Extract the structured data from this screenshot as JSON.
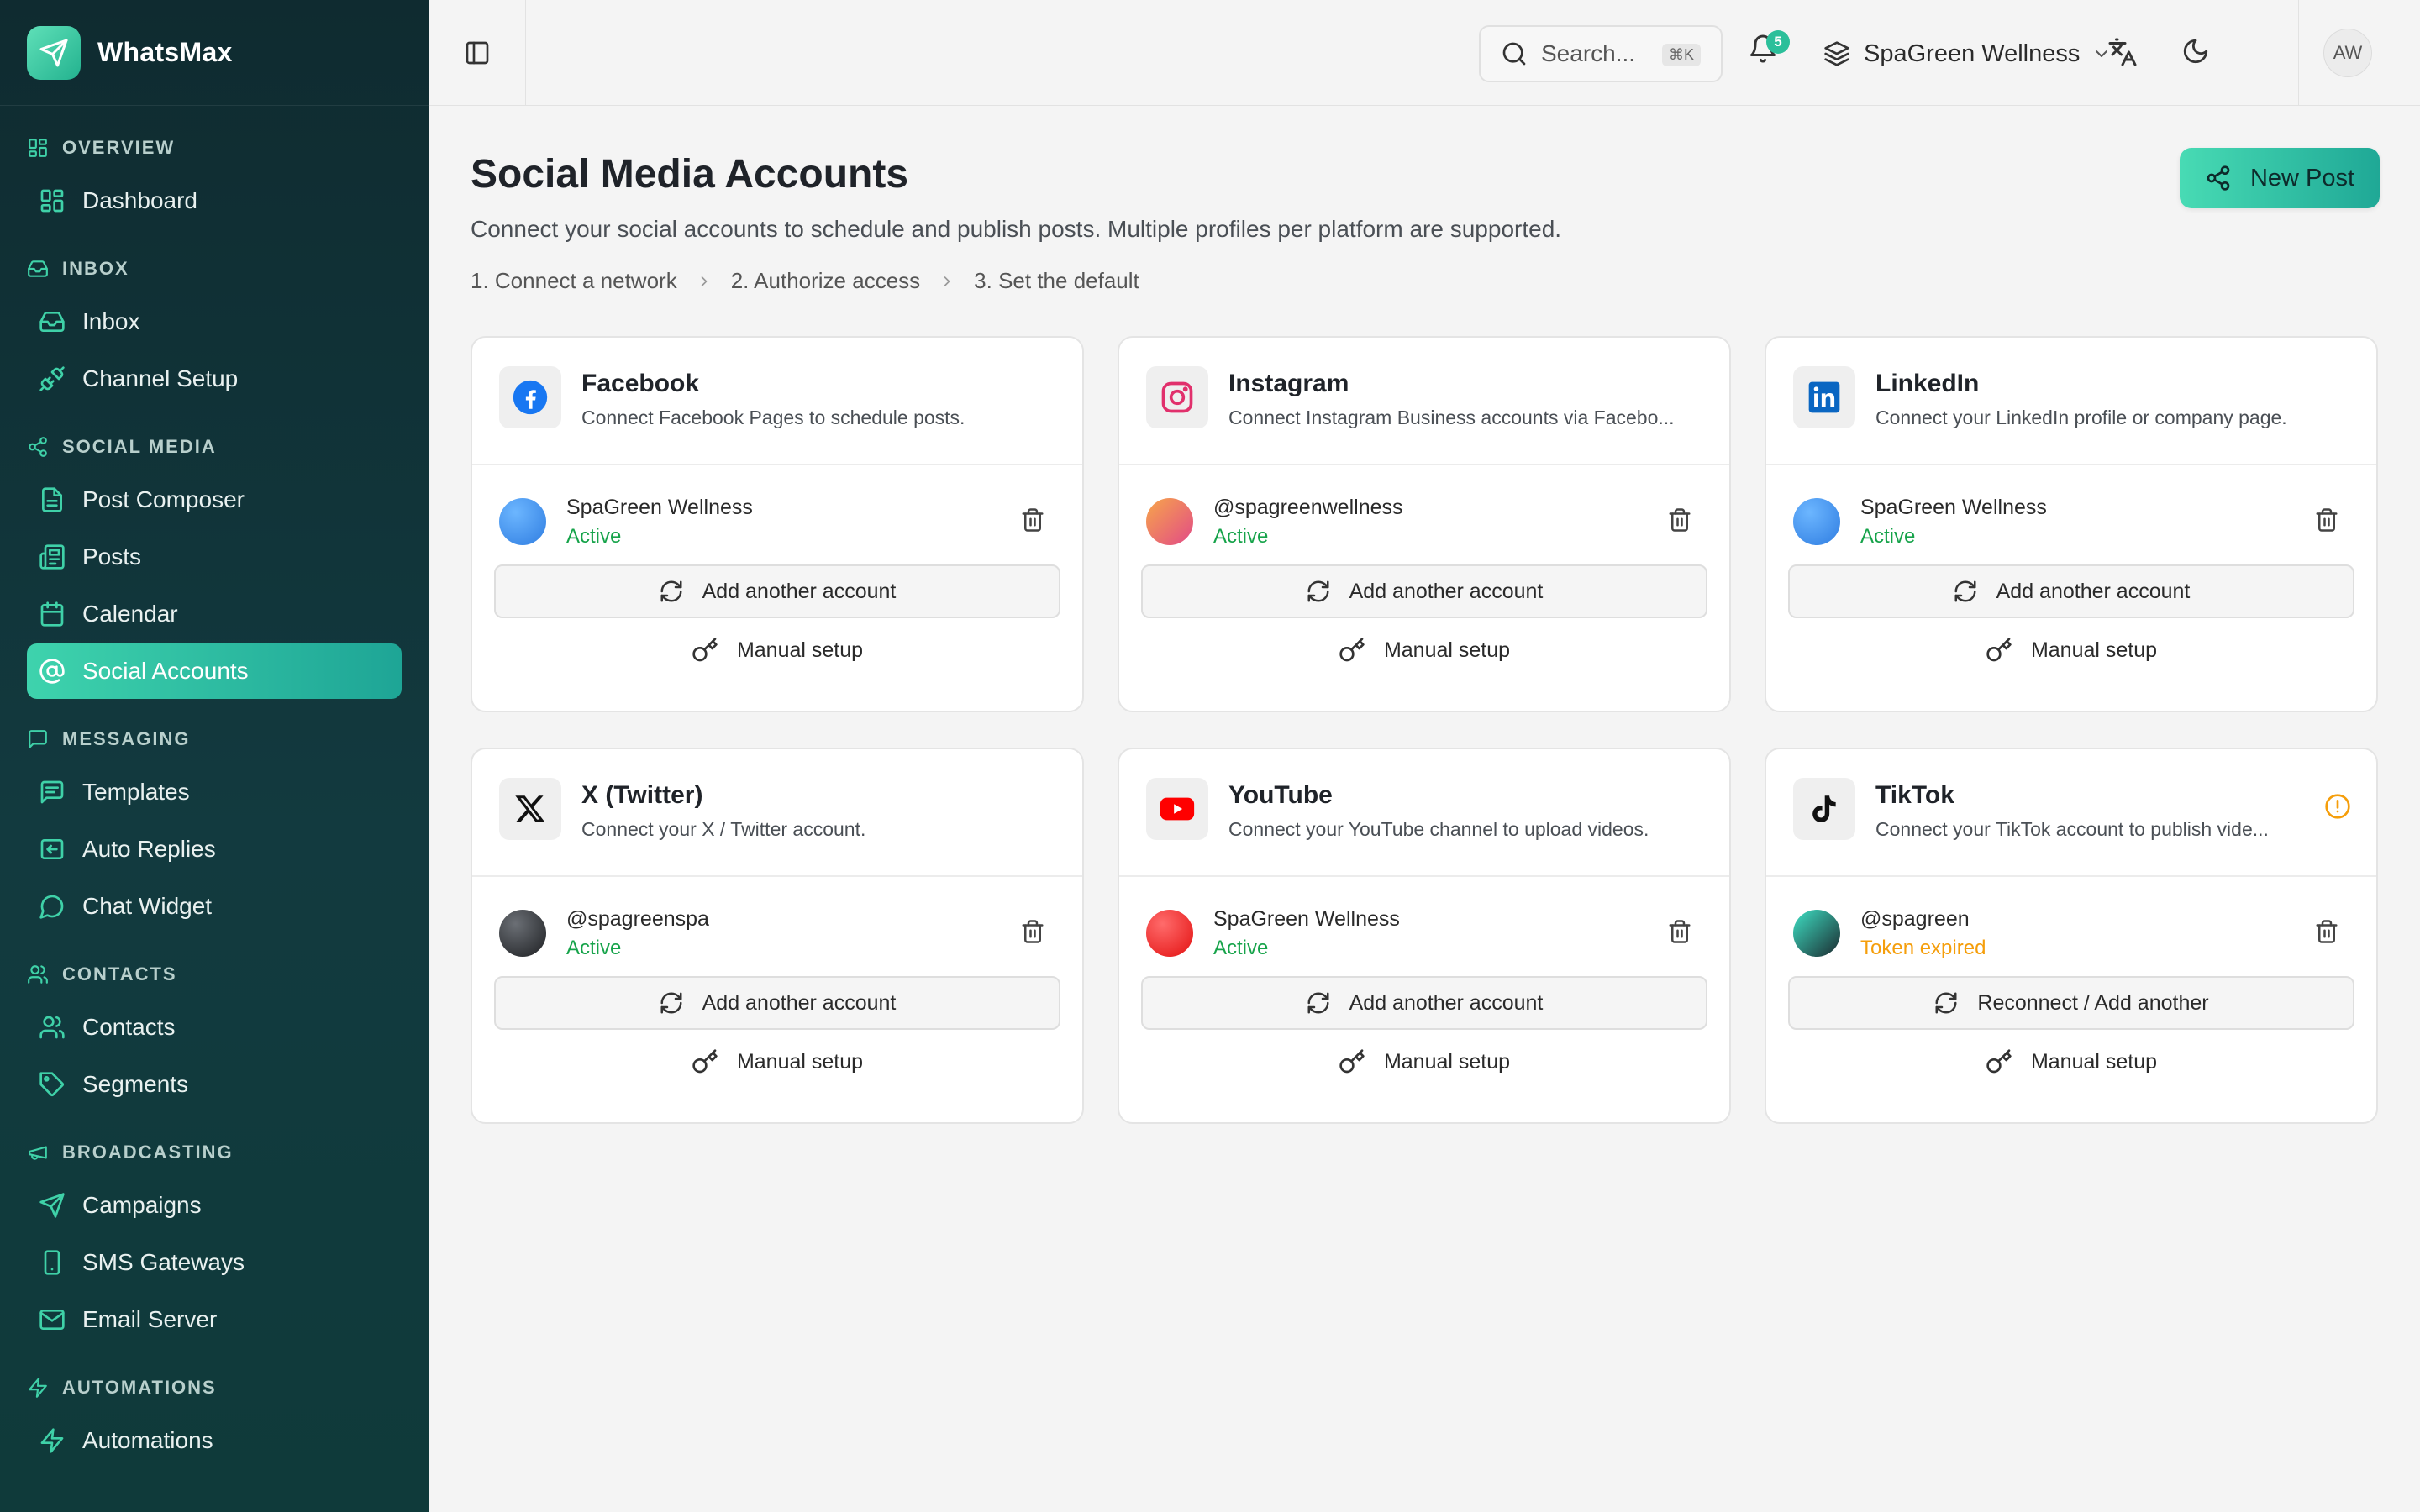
{
  "app": {
    "name": "WhatsMax"
  },
  "sidebar": {
    "sections": [
      {
        "label": "OVERVIEW",
        "icon": "grid-icon",
        "items": [
          {
            "label": "Dashboard",
            "icon": "dashboard-icon"
          }
        ]
      },
      {
        "label": "INBOX",
        "icon": "inbox-icon",
        "items": [
          {
            "label": "Inbox",
            "icon": "inbox-icon"
          },
          {
            "label": "Channel Setup",
            "icon": "plug-icon"
          }
        ]
      },
      {
        "label": "SOCIAL MEDIA",
        "icon": "share-icon",
        "items": [
          {
            "label": "Post Composer",
            "icon": "file-icon"
          },
          {
            "label": "Posts",
            "icon": "newspaper-icon"
          },
          {
            "label": "Calendar",
            "icon": "calendar-icon"
          },
          {
            "label": "Social Accounts",
            "icon": "at-icon",
            "active": true
          }
        ]
      },
      {
        "label": "MESSAGING",
        "icon": "message-icon",
        "items": [
          {
            "label": "Templates",
            "icon": "template-icon"
          },
          {
            "label": "Auto Replies",
            "icon": "reply-icon"
          },
          {
            "label": "Chat Widget",
            "icon": "chat-icon"
          }
        ]
      },
      {
        "label": "CONTACTS",
        "icon": "users-icon",
        "items": [
          {
            "label": "Contacts",
            "icon": "users-icon"
          },
          {
            "label": "Segments",
            "icon": "tag-icon"
          }
        ]
      },
      {
        "label": "BROADCASTING",
        "icon": "megaphone-icon",
        "items": [
          {
            "label": "Campaigns",
            "icon": "send-icon"
          },
          {
            "label": "SMS Gateways",
            "icon": "phone-icon"
          },
          {
            "label": "Email Server",
            "icon": "mail-icon"
          }
        ]
      },
      {
        "label": "AUTOMATIONS",
        "icon": "bolt-icon",
        "items": [
          {
            "label": "Automations",
            "icon": "bolt-icon"
          }
        ]
      }
    ]
  },
  "topbar": {
    "search_placeholder": "Search...",
    "search_shortcut": "⌘K",
    "notification_count": "5",
    "workspace": "SpaGreen Wellness",
    "avatar_initials": "AW"
  },
  "page": {
    "title": "Social Media Accounts",
    "subtitle": "Connect your social accounts to schedule and publish posts. Multiple profiles per platform are supported.",
    "steps": [
      "1.  Connect a network",
      "2.  Authorize access",
      "3.  Set the default"
    ],
    "new_post_label": "New Post"
  },
  "colors": {
    "accent": "#2bbf9a",
    "active_status": "#16a34a",
    "warning_status": "#f59e0b"
  },
  "platforms": [
    {
      "name": "Facebook",
      "description": "Connect Facebook Pages to schedule posts.",
      "icon": "facebook-icon",
      "account": {
        "name": "SpaGreen Wellness",
        "status": "Active",
        "status_kind": "active"
      },
      "action_label": "Add another account",
      "manual_label": "Manual setup",
      "warning": false
    },
    {
      "name": "Instagram",
      "description": "Connect Instagram Business accounts via Facebo...",
      "icon": "instagram-icon",
      "account": {
        "name": "@spagreenwellness",
        "status": "Active",
        "status_kind": "active"
      },
      "action_label": "Add another account",
      "manual_label": "Manual setup",
      "warning": false
    },
    {
      "name": "LinkedIn",
      "description": "Connect your LinkedIn profile or company page.",
      "icon": "linkedin-icon",
      "account": {
        "name": "SpaGreen Wellness",
        "status": "Active",
        "status_kind": "active"
      },
      "action_label": "Add another account",
      "manual_label": "Manual setup",
      "warning": false
    },
    {
      "name": "X (Twitter)",
      "description": "Connect your X / Twitter account.",
      "icon": "x-icon",
      "account": {
        "name": "@spagreenspa",
        "status": "Active",
        "status_kind": "active"
      },
      "action_label": "Add another account",
      "manual_label": "Manual setup",
      "warning": false
    },
    {
      "name": "YouTube",
      "description": "Connect your YouTube channel to upload videos.",
      "icon": "youtube-icon",
      "account": {
        "name": "SpaGreen Wellness",
        "status": "Active",
        "status_kind": "active"
      },
      "action_label": "Add another account",
      "manual_label": "Manual setup",
      "warning": false
    },
    {
      "name": "TikTok",
      "description": "Connect your TikTok account to publish vide...",
      "icon": "tiktok-icon",
      "account": {
        "name": "@spagreen",
        "status": "Token expired",
        "status_kind": "expired"
      },
      "action_label": "Reconnect / Add another",
      "manual_label": "Manual setup",
      "warning": true
    }
  ]
}
